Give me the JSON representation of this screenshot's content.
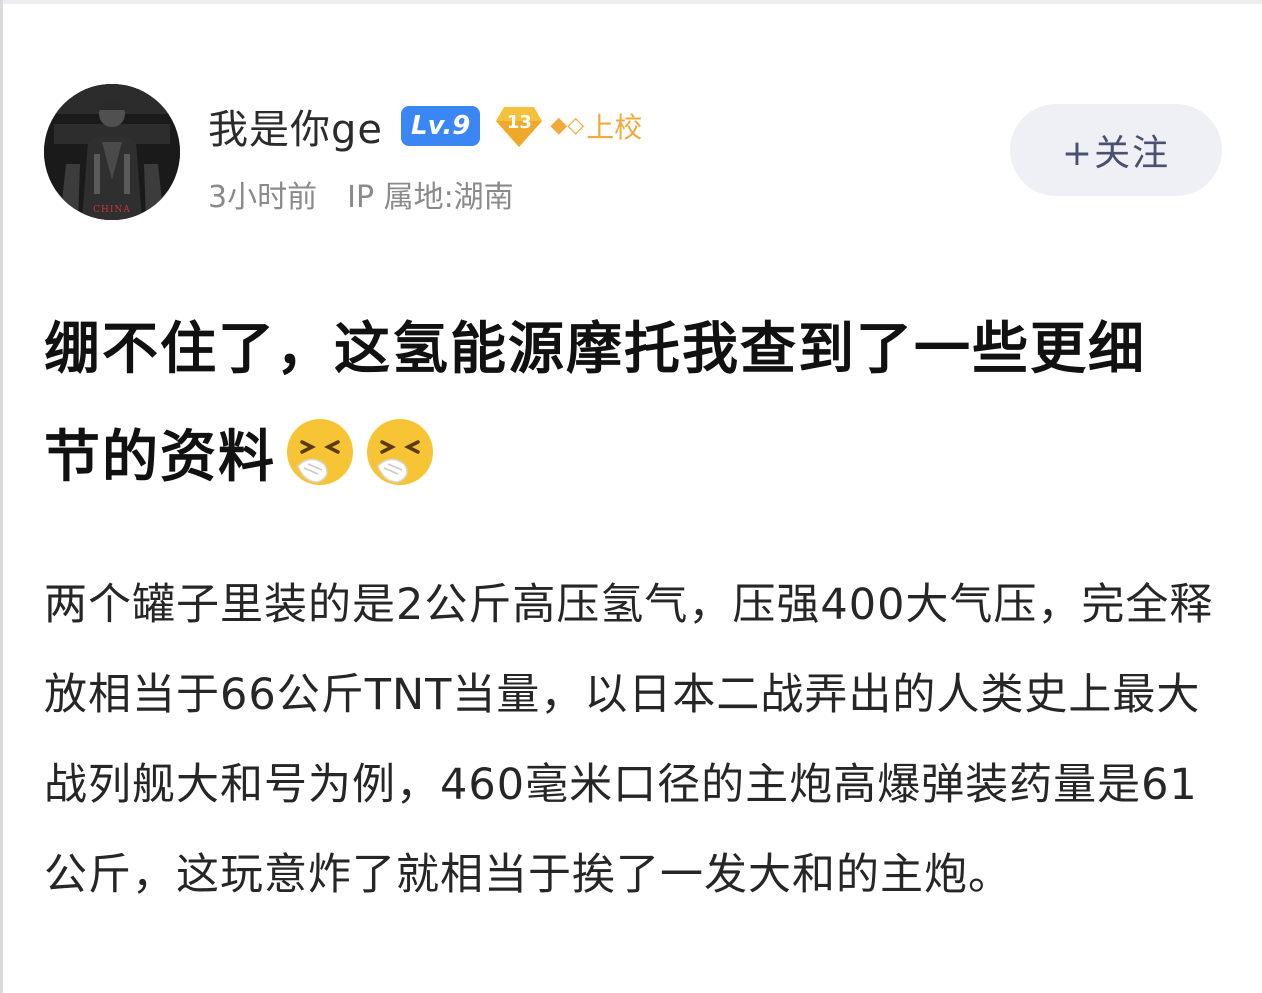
{
  "post": {
    "author": {
      "username": "我是你ge",
      "level_badge": "Lv.9",
      "vip_badge": "13",
      "rank_title": "上校",
      "avatar_watermark": "CHINA"
    },
    "meta": {
      "time_ago": "3小时前",
      "ip_location": "IP 属地:湖南"
    },
    "follow_label": "+关注",
    "title": "绷不住了，这氢能源摩托我查到了一些更细节的资料",
    "title_emojis": [
      "sneezing-face-emoji",
      "sneezing-face-emoji"
    ],
    "body": "两个罐子里装的是2公斤高压氢气，压强400大气压，完全释放相当于66公斤TNT当量，以日本二战弄出的人类史上最大战列舰大和号为例，460毫米口径的主炮高爆弹装药量是61公斤，这玩意炸了就相当于挨了一发大和的主炮。"
  },
  "colors": {
    "level_badge": "#3a86f4",
    "rank": "#f2a93b",
    "follow_bg": "#eef0f6",
    "meta_text": "#8a8a8a"
  }
}
